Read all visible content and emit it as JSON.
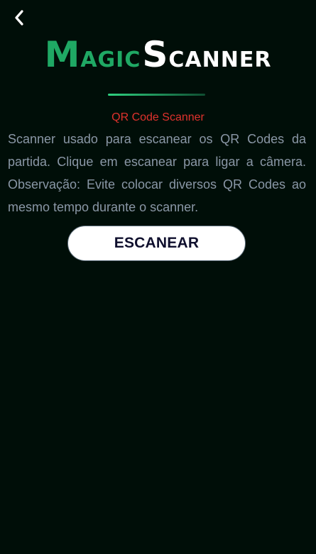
{
  "header": {
    "back_icon": "chevron-left-icon"
  },
  "logo": {
    "magic_initial": "M",
    "magic_rest": "AGIC",
    "scanner_initial": "S",
    "scanner_rest": "CANNER",
    "colors": {
      "magic": "#1fa864",
      "scanner": "#ffffff"
    }
  },
  "main": {
    "subtitle": "QR Code Scanner",
    "description": "Scanner usado para escanear os QR Codes da partida. Clique em escanear para ligar a câmera. Observação: Evite colocar diversos QR Codes ao mesmo tempo durante o scanner.",
    "scan_button_label": "ESCANEAR"
  },
  "colors": {
    "background": "#000e08",
    "subtitle": "#e0322d",
    "description": "#8a97a6",
    "accent": "#1fa864"
  }
}
